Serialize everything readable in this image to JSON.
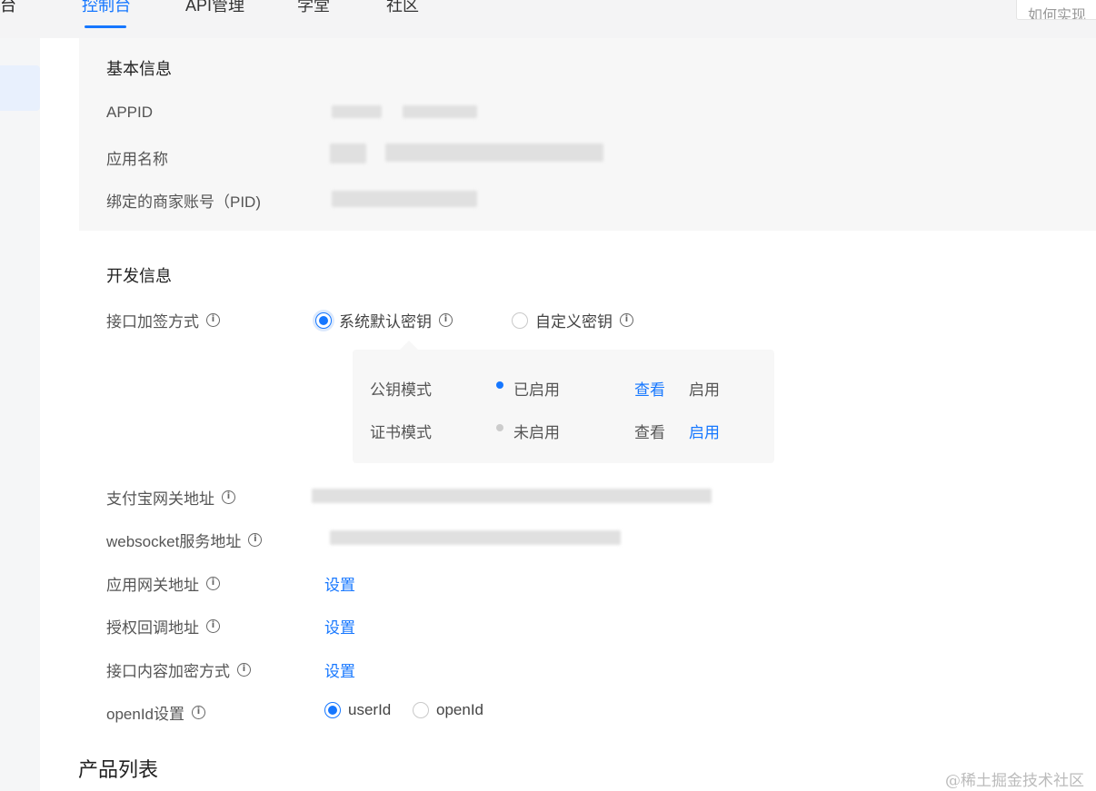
{
  "nav": {
    "partial_left": "台",
    "tabs": [
      {
        "label": "控制台",
        "active": true
      },
      {
        "label": "API管理"
      },
      {
        "label": "学堂"
      },
      {
        "label": "社区"
      }
    ],
    "search_placeholder": "如何实现"
  },
  "basic_info": {
    "title": "基本信息",
    "rows": [
      {
        "label": "APPID"
      },
      {
        "label": "应用名称"
      },
      {
        "label": "绑定的商家账号（PID)"
      }
    ]
  },
  "dev_info": {
    "title": "开发信息",
    "sign_method": {
      "label": "接口加签方式",
      "options": [
        {
          "label": "系统默认密钥",
          "selected": true
        },
        {
          "label": "自定义密钥",
          "selected": false
        }
      ]
    },
    "key_modes": [
      {
        "mode": "公钥模式",
        "status": "已启用",
        "status_color": "#1677ff",
        "view": "查看",
        "enable": "启用"
      },
      {
        "mode": "证书模式",
        "status": "未启用",
        "status_color": "#cccccc",
        "view": "查看",
        "enable": "启用"
      }
    ],
    "gateway": {
      "label": "支付宝网关地址"
    },
    "websocket": {
      "label": "websocket服务地址"
    },
    "app_gateway": {
      "label": "应用网关地址",
      "action": "设置"
    },
    "auth_callback": {
      "label": "授权回调地址",
      "action": "设置"
    },
    "content_encrypt": {
      "label": "接口内容加密方式",
      "action": "设置"
    },
    "openid": {
      "label": "openId设置",
      "options": [
        {
          "label": "userId",
          "selected": true
        },
        {
          "label": "openId",
          "selected": false
        }
      ]
    }
  },
  "products": {
    "title": "产品列表"
  },
  "watermark": "@稀土掘金技术社区",
  "colors": {
    "accent": "#1677ff",
    "panel_bg": "#f7f7f7"
  }
}
